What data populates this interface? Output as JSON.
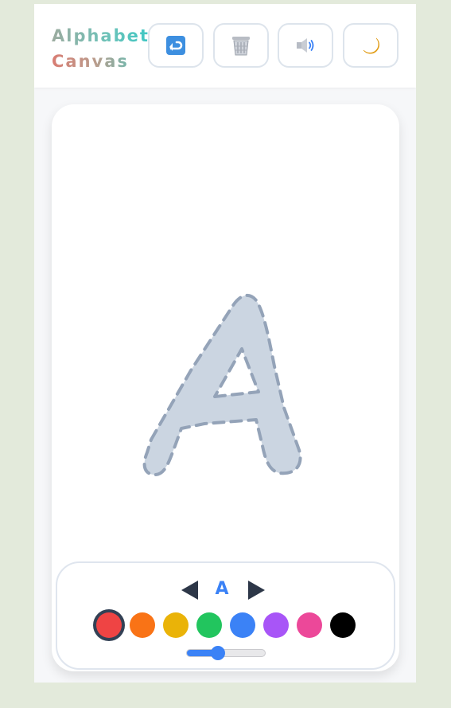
{
  "header": {
    "title_line1": "Alphabet",
    "title_line2": "Canvas",
    "buttons": [
      {
        "icon": "undo-icon"
      },
      {
        "icon": "trash-icon"
      },
      {
        "icon": "speaker-icon"
      },
      {
        "icon": "moon-icon"
      }
    ]
  },
  "canvas": {
    "trace_letter": "A",
    "trace_fill": "#cbd5e1",
    "trace_stroke": "#94a3b8"
  },
  "controls": {
    "current_letter": "A",
    "colors": [
      "#ef4444",
      "#f97316",
      "#eab308",
      "#22c55e",
      "#3b82f6",
      "#a855f7",
      "#ec4899",
      "#000000"
    ],
    "selected_color": "#ef4444",
    "brush_size_fraction": 0.4
  }
}
